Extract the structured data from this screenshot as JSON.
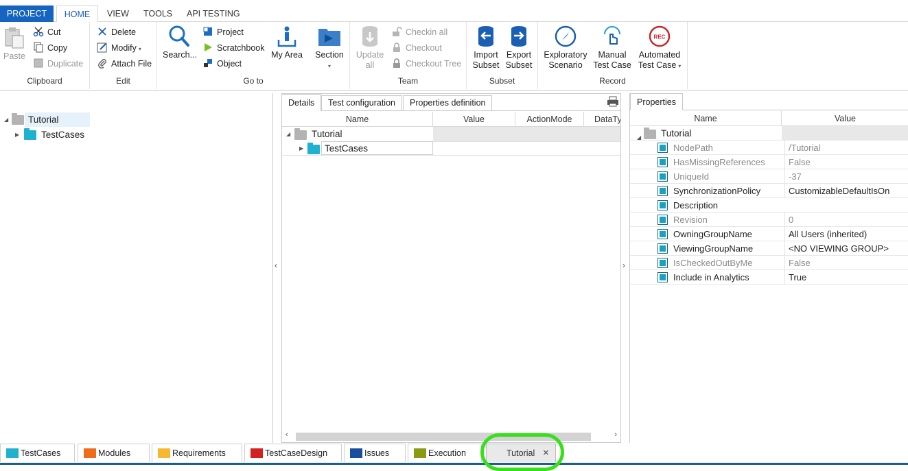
{
  "ribbon_tabs": {
    "project": "PROJECT",
    "home": "HOME",
    "view": "VIEW",
    "tools": "TOOLS",
    "api": "API TESTING"
  },
  "clipboard": {
    "paste": "Paste",
    "cut": "Cut",
    "copy": "Copy",
    "duplicate": "Duplicate",
    "label": "Clipboard"
  },
  "edit": {
    "delete": "Delete",
    "modify": "Modify",
    "attach": "Attach File",
    "label": "Edit"
  },
  "goto": {
    "search": "Search...",
    "project": "Project",
    "scratchbook": "Scratchbook",
    "object": "Object",
    "myarea": "My Area",
    "section": "Section",
    "label": "Go to"
  },
  "team": {
    "update1": "Update",
    "update2": "all",
    "checkin_all": "Checkin all",
    "checkout": "Checkout",
    "checkout_tree": "Checkout Tree",
    "label": "Team"
  },
  "subset": {
    "import1": "Import",
    "import2": "Subset",
    "export1": "Export",
    "export2": "Subset",
    "label": "Subset"
  },
  "record": {
    "expl1": "Exploratory",
    "expl2": "Scenario",
    "manual1": "Manual",
    "manual2": "Test Case",
    "auto1": "Automated",
    "auto2": "Test Case",
    "rec_badge": "REC",
    "label": "Record"
  },
  "left_tree": {
    "root": "Tutorial",
    "child": "TestCases"
  },
  "mid_tabs": {
    "details": "Details",
    "test_config": "Test configuration",
    "props_def": "Properties definition"
  },
  "mid_grid": {
    "columns": [
      "Name",
      "Value",
      "ActionMode",
      "DataTy"
    ],
    "root": "Tutorial",
    "child": "TestCases"
  },
  "right_tabs": {
    "properties": "Properties"
  },
  "props_grid": {
    "columns": [
      "Name",
      "Value"
    ],
    "root": "Tutorial",
    "rows": [
      {
        "name": "NodePath",
        "value": "/Tutorial"
      },
      {
        "name": "HasMissingReferences",
        "value": "False"
      },
      {
        "name": "UniqueId",
        "value": "-37"
      },
      {
        "name": "SynchronizationPolicy",
        "value": "CustomizableDefaultIsOn"
      },
      {
        "name": "Description",
        "value": ""
      },
      {
        "name": "Revision",
        "value": "0"
      },
      {
        "name": "OwningGroupName",
        "value": "All Users (inherited)"
      },
      {
        "name": "ViewingGroupName",
        "value": "<NO VIEWING GROUP>"
      },
      {
        "name": "IsCheckedOutByMe",
        "value": "False"
      },
      {
        "name": "Include in Analytics",
        "value": "True"
      }
    ]
  },
  "bottom_tabs": {
    "testcases": "TestCases",
    "modules": "Modules",
    "requirements": "Requirements",
    "testcasedesign": "TestCaseDesign",
    "issues": "Issues",
    "execution": "Execution",
    "tutorial": "Tutorial",
    "close": "×"
  },
  "colors": {
    "accent": "#1565c0",
    "teal": "#1aa0c0",
    "highlight": "#37e01b"
  }
}
